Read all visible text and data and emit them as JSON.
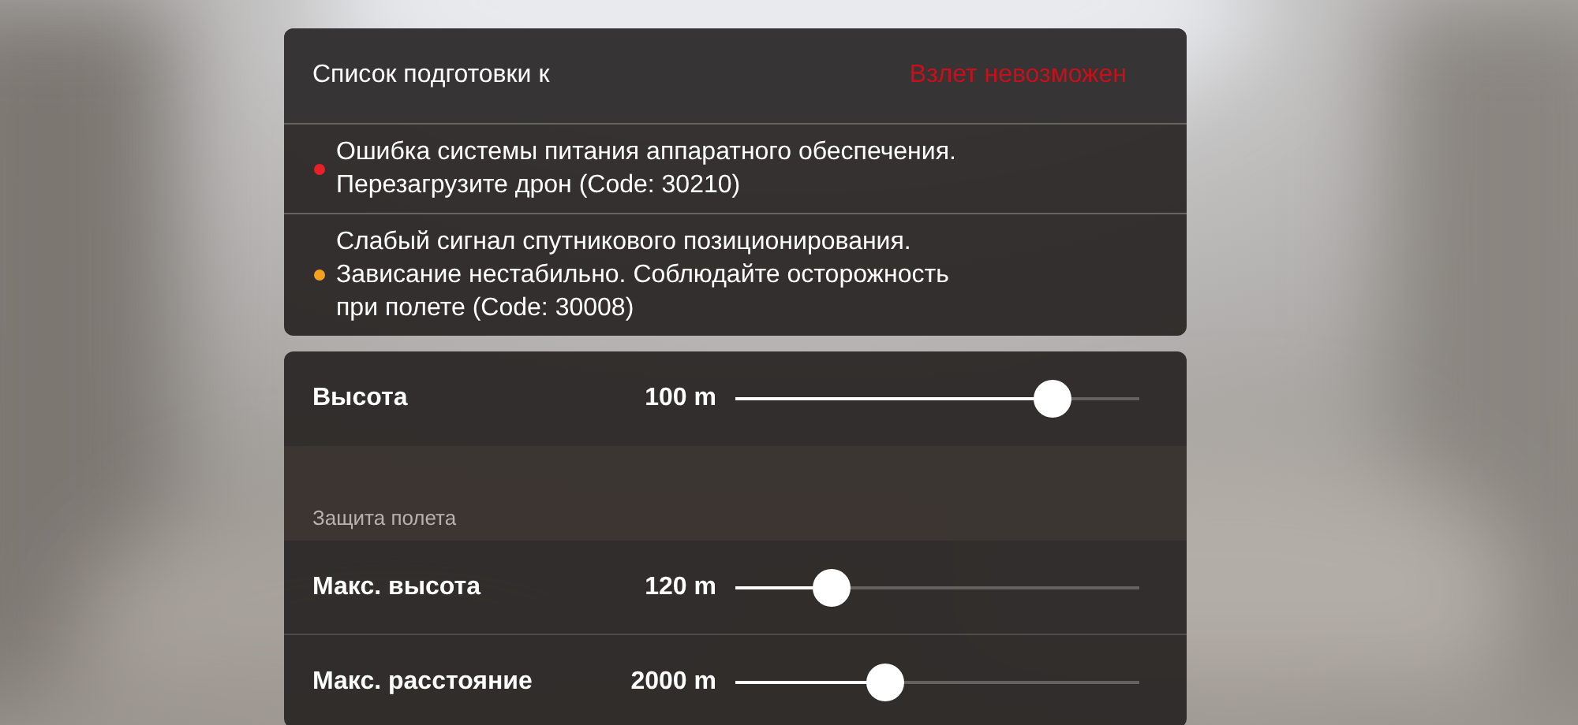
{
  "checklist": {
    "title": "Список подготовки к",
    "status": "Взлет невозможен",
    "items": [
      {
        "text": "Ошибка системы питания аппаратного обеспечения.\nПерезагрузите дрон (Code: 30210)",
        "color": "#e8202a"
      },
      {
        "text": "Слабый сигнал спутникового позиционирования.\nЗависание нестабильно. Соблюдайте осторожность\nпри полете (Code: 30008)",
        "color": "#f5a01e"
      }
    ]
  },
  "settings": [
    {
      "kind": "slider",
      "label": "Высота",
      "value": "100 m",
      "level": 0.785
    },
    {
      "kind": "section",
      "label": "Защита полета"
    },
    {
      "kind": "slider",
      "label": "Макс. высота",
      "value": "120 m",
      "level": 0.24
    },
    {
      "kind": "slider",
      "label": "Макс. расстояние",
      "value": "2000 m",
      "level": 0.37
    }
  ]
}
